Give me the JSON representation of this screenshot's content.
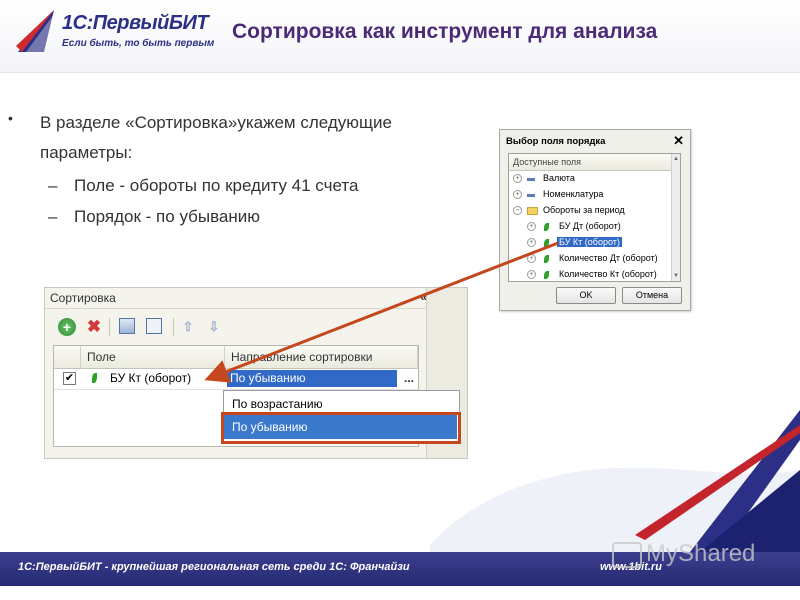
{
  "header": {
    "logo_brand": "1С:ПервыйБИТ",
    "logo_slogan": "Если быть, то быть первым",
    "title": "Сортировка как инструмент для анализа"
  },
  "bullets": {
    "main": "В разделе «Сортировка»укажем следующие параметры:",
    "sub1": "Поле - обороты по кредиту 41 счета",
    "sub2": "Порядок - по убыванию"
  },
  "dialog": {
    "title": "Выбор поля порядка",
    "close": "✕",
    "column": "Доступные поля",
    "items": [
      {
        "label": "Валюта",
        "icon": "dash-icon",
        "expander": "+"
      },
      {
        "label": "Номенклатура",
        "icon": "dash-icon",
        "expander": "+"
      },
      {
        "label": "Обороты за период",
        "icon": "folder-icon",
        "expander": "−"
      },
      {
        "label": "БУ Дт (оборот)",
        "icon": "leaf-icon",
        "expander": "+"
      },
      {
        "label": "БУ Кт (оборот)",
        "icon": "leaf-icon",
        "expander": "+",
        "selected": true
      },
      {
        "label": "Количество Дт (оборот)",
        "icon": "leaf-icon",
        "expander": "+"
      },
      {
        "label": "Количество Кт (оборот)",
        "icon": "leaf-icon",
        "expander": "+"
      }
    ],
    "ok": "OK",
    "cancel": "Отмена"
  },
  "panel": {
    "title": "Сортировка",
    "nav": "« »",
    "col_field": "Поле",
    "col_direction": "Направление сортировки",
    "row": {
      "checked": "✔",
      "field": "БУ Кт (оборот)",
      "direction": "По убыванию",
      "more": "..."
    },
    "dropdown": [
      "По возрастанию",
      "По убыванию"
    ]
  },
  "footer": {
    "left": "1С:ПервыйБИТ - крупнейшая региональная сеть среди 1С: Франчайзи",
    "right": "www.1bit.ru"
  },
  "watermark": "MyShared",
  "colors": {
    "title": "#4b2a78",
    "brand": "#2b2f86",
    "selection": "#3169c6",
    "highlight": "#c4471d",
    "footer": "#2b2f7e"
  }
}
